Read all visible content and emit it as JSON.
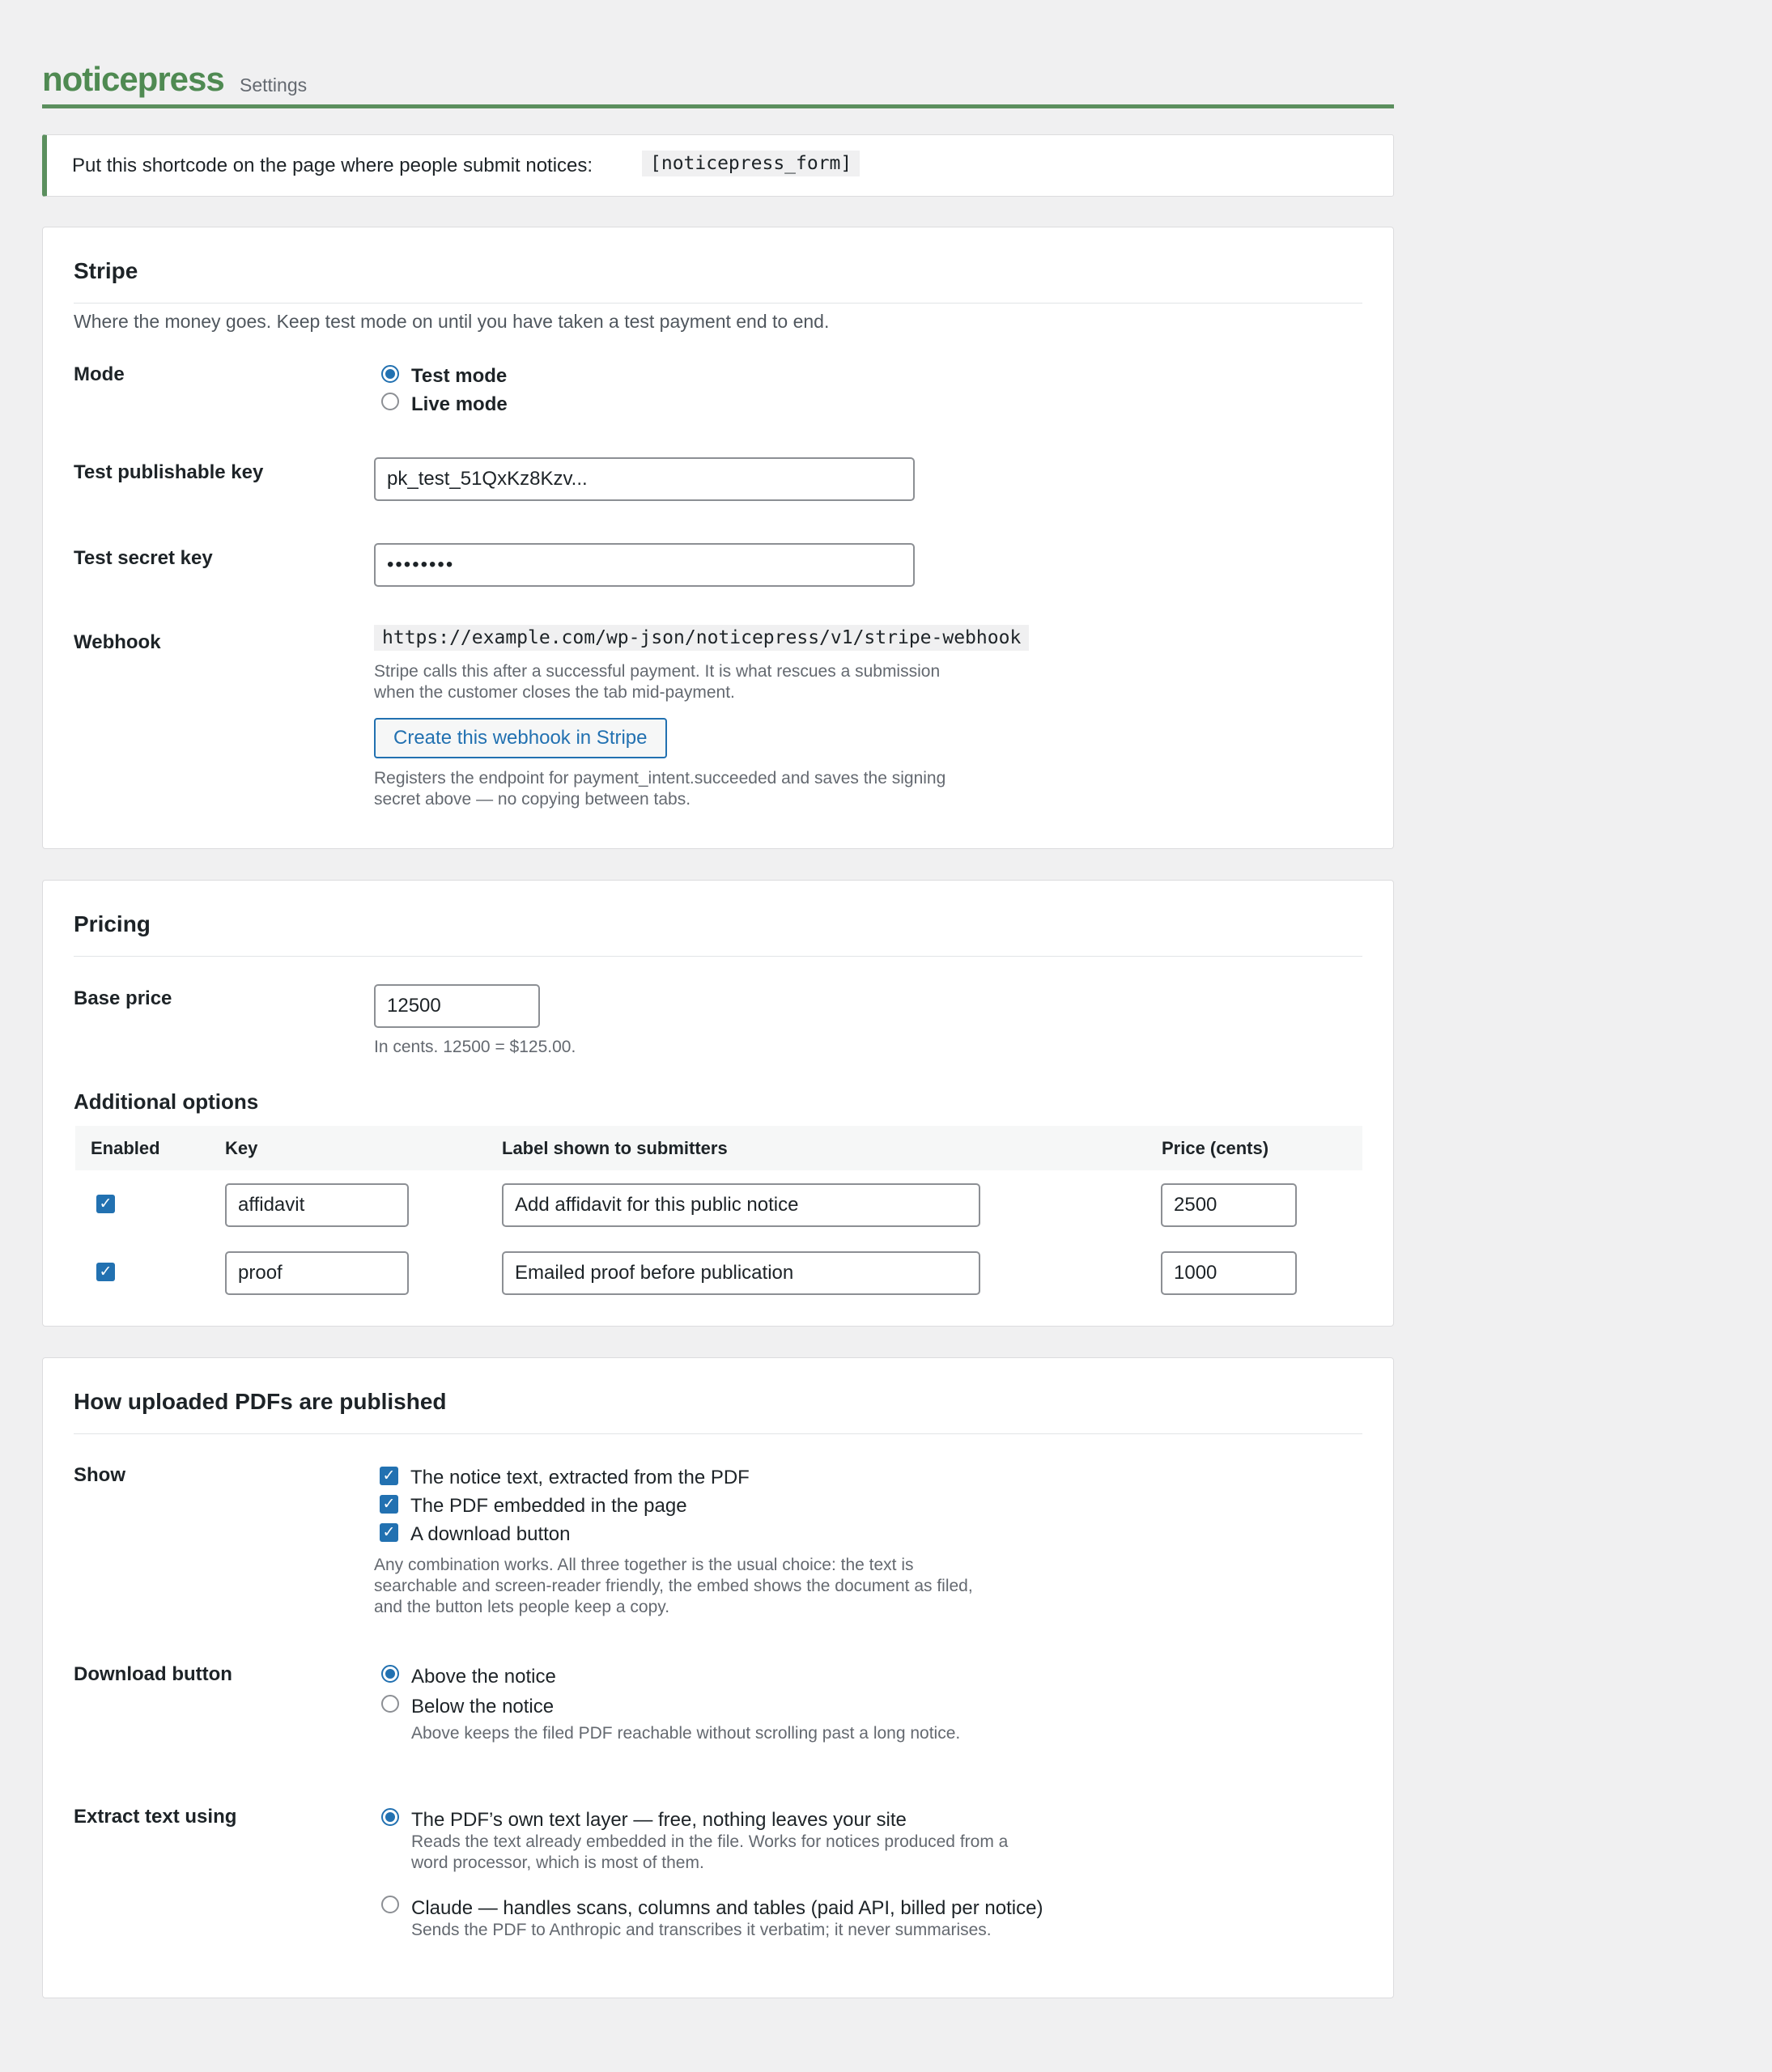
{
  "header": {
    "brand": "noticepress",
    "subtitle": "Settings"
  },
  "shortcode_notice": {
    "text": "Put this shortcode on the page where people submit notices:",
    "code": "[noticepress_form]"
  },
  "stripe": {
    "title": "Stripe",
    "description": "Where the money goes. Keep test mode on until you have taken a test payment end to end.",
    "mode_label": "Mode",
    "mode_options": [
      "Test mode",
      "Live mode"
    ],
    "mode_selected": "Test mode",
    "pub_key_label": "Test publishable key",
    "pub_key_value": "pk_test_51QxKz8Kzv...",
    "secret_key_label": "Test secret key",
    "secret_key_value": "••••••••",
    "webhook_label": "Webhook",
    "webhook_url": "https://example.com/wp-json/noticepress/v1/stripe-webhook",
    "webhook_help_1": "Stripe calls this after a successful payment. It is what rescues a submission",
    "webhook_help_2": "when the customer closes the tab mid-payment.",
    "webhook_button": "Create this webhook in Stripe",
    "button_help_1": "Registers the endpoint for payment_intent.succeeded and saves the signing",
    "button_help_2": "secret above — no copying between tabs."
  },
  "pricing": {
    "title": "Pricing",
    "base_price_label": "Base price",
    "base_price_value": "12500",
    "base_price_help": "In cents. 12500 = $125.00.",
    "additional_title": "Additional options",
    "columns": [
      "Enabled",
      "Key",
      "Label shown to submitters",
      "Price (cents)"
    ],
    "rows": [
      {
        "enabled": true,
        "key": "affidavit",
        "label": "Add affidavit for this public notice",
        "price": "2500"
      },
      {
        "enabled": true,
        "key": "proof",
        "label": "Emailed proof before publication",
        "price": "1000"
      }
    ]
  },
  "pdfs": {
    "title": "How uploaded PDFs are published",
    "show_label": "Show",
    "show_options": [
      "The notice text, extracted from the PDF",
      "The PDF embedded in the page",
      "A download button"
    ],
    "show_help_1": "Any combination works. All three together is the usual choice: the text is",
    "show_help_2": "searchable and screen-reader friendly, the embed shows the document as filed,",
    "show_help_3": "and the button lets people keep a copy.",
    "download_label": "Download button",
    "download_options": [
      "Above the notice",
      "Below the notice"
    ],
    "download_selected": "Above the notice",
    "download_help": "Above keeps the filed PDF reachable without scrolling past a long notice.",
    "extract_label": "Extract text using",
    "extract_option_1": "The PDF’s own text layer — free, nothing leaves your site",
    "extract_option_1_help_1": "Reads the text already embedded in the file. Works for notices produced from a",
    "extract_option_1_help_2": "word processor, which is most of them.",
    "extract_option_2": "Claude — handles scans, columns and tables (paid API, billed per notice)",
    "extract_option_2_help": "Sends the PDF to Anthropic and transcribes it verbatim; it never summarises.",
    "extract_selected": "The PDF’s own text layer — free, nothing leaves your site"
  },
  "colors": {
    "brand": "#4f8a52",
    "accent": "#2271b1",
    "background": "#f0f0f1"
  }
}
